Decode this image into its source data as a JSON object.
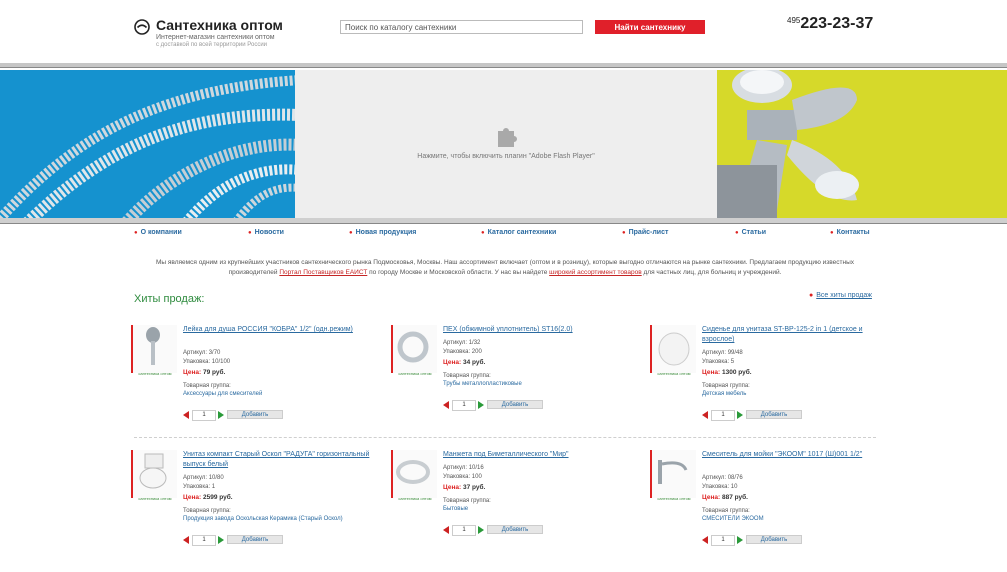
{
  "header": {
    "logo_title": "Сантехника оптом",
    "logo_tagline": "Интернет-магазин сантехники оптом",
    "logo_subtagline": "с доставкой по всей территории России",
    "search_placeholder": "Поиск по каталогу сантехники",
    "search_button": "Найти сантехнику",
    "phone_code": "495",
    "phone_number": "223-23-37"
  },
  "banner": {
    "flash_text": "Нажмите, чтобы включить плагин \"Adobe Flash Player\"",
    "left_bg": "#1592cf",
    "right_bg": "#d6d92a"
  },
  "nav": [
    "О компании",
    "Новости",
    "Новая продукция",
    "Каталог сантехники",
    "Прайс-лист",
    "Статьи",
    "Контакты"
  ],
  "intro": {
    "text1": "Мы являемся одним из крупнейших участников сантехнического рынка Подмосковья, Москвы. Наш ассортимент включает (оптом и в розницу), которые выгодно отличаются на рынке сантехники.",
    "text2": "Предлагаем продукцию известных производителей",
    "link": "Портал Поставщиков ЕАИСТ",
    "text3": "по городу Москве и Московской области. У нас вы найдете",
    "link2": "широкий ассортимент товаров",
    "text4": "для частных лиц, для больниц и учреждений."
  },
  "hits": {
    "title": "Хиты продаж:",
    "all_link": "Все хиты продаж"
  },
  "labels": {
    "article": "Артикул:",
    "package": "Упаковка:",
    "price": "Цена:",
    "group": "Товарная группа:",
    "add": "Добавить",
    "thumb_caption": "сантехника оптом"
  },
  "products": [
    {
      "name": "Лейка для душа РОССИЯ \"КОБРА\" 1/2\" (одн.режим)",
      "article": "3/70",
      "package": "10/100",
      "price": "79 руб.",
      "group": "Аксессуары для смесителей",
      "qty": "1"
    },
    {
      "name": "ПЕХ (обжимной уплотнитель) ST16(2.0)",
      "article": "1/32",
      "package": "200",
      "price": "34 руб.",
      "group": "Трубы металлопластиковые",
      "qty": "1"
    },
    {
      "name": "Сиденье для унитаза ST-BP-125-2 in 1 (детское и взрослое)",
      "article": "99/48",
      "package": "5",
      "price": "1300 руб.",
      "group": "Детская мебель",
      "qty": "1"
    },
    {
      "name": "Унитаз компакт Старый Оскол \"РАДУГА\" горизонтальный выпуск белый",
      "article": "10/80",
      "package": "1",
      "price": "2599 руб.",
      "group": "Продукция завода Оскольская Керамика (Старый Оскол)",
      "qty": "1"
    },
    {
      "name": "Манжета под Биметаллического \"Мир\"",
      "article": "10/16",
      "package": "100",
      "price": "37 руб.",
      "group": "Бытовые",
      "qty": "1"
    },
    {
      "name": "Смеситель для мойки \"ЭКООМ\" 1017 (Ш)001 1/2\"",
      "article": "08/76",
      "package": "10",
      "price": "887 руб.",
      "group": "СМЕСИТЕЛИ ЭКООМ",
      "qty": "1"
    }
  ]
}
